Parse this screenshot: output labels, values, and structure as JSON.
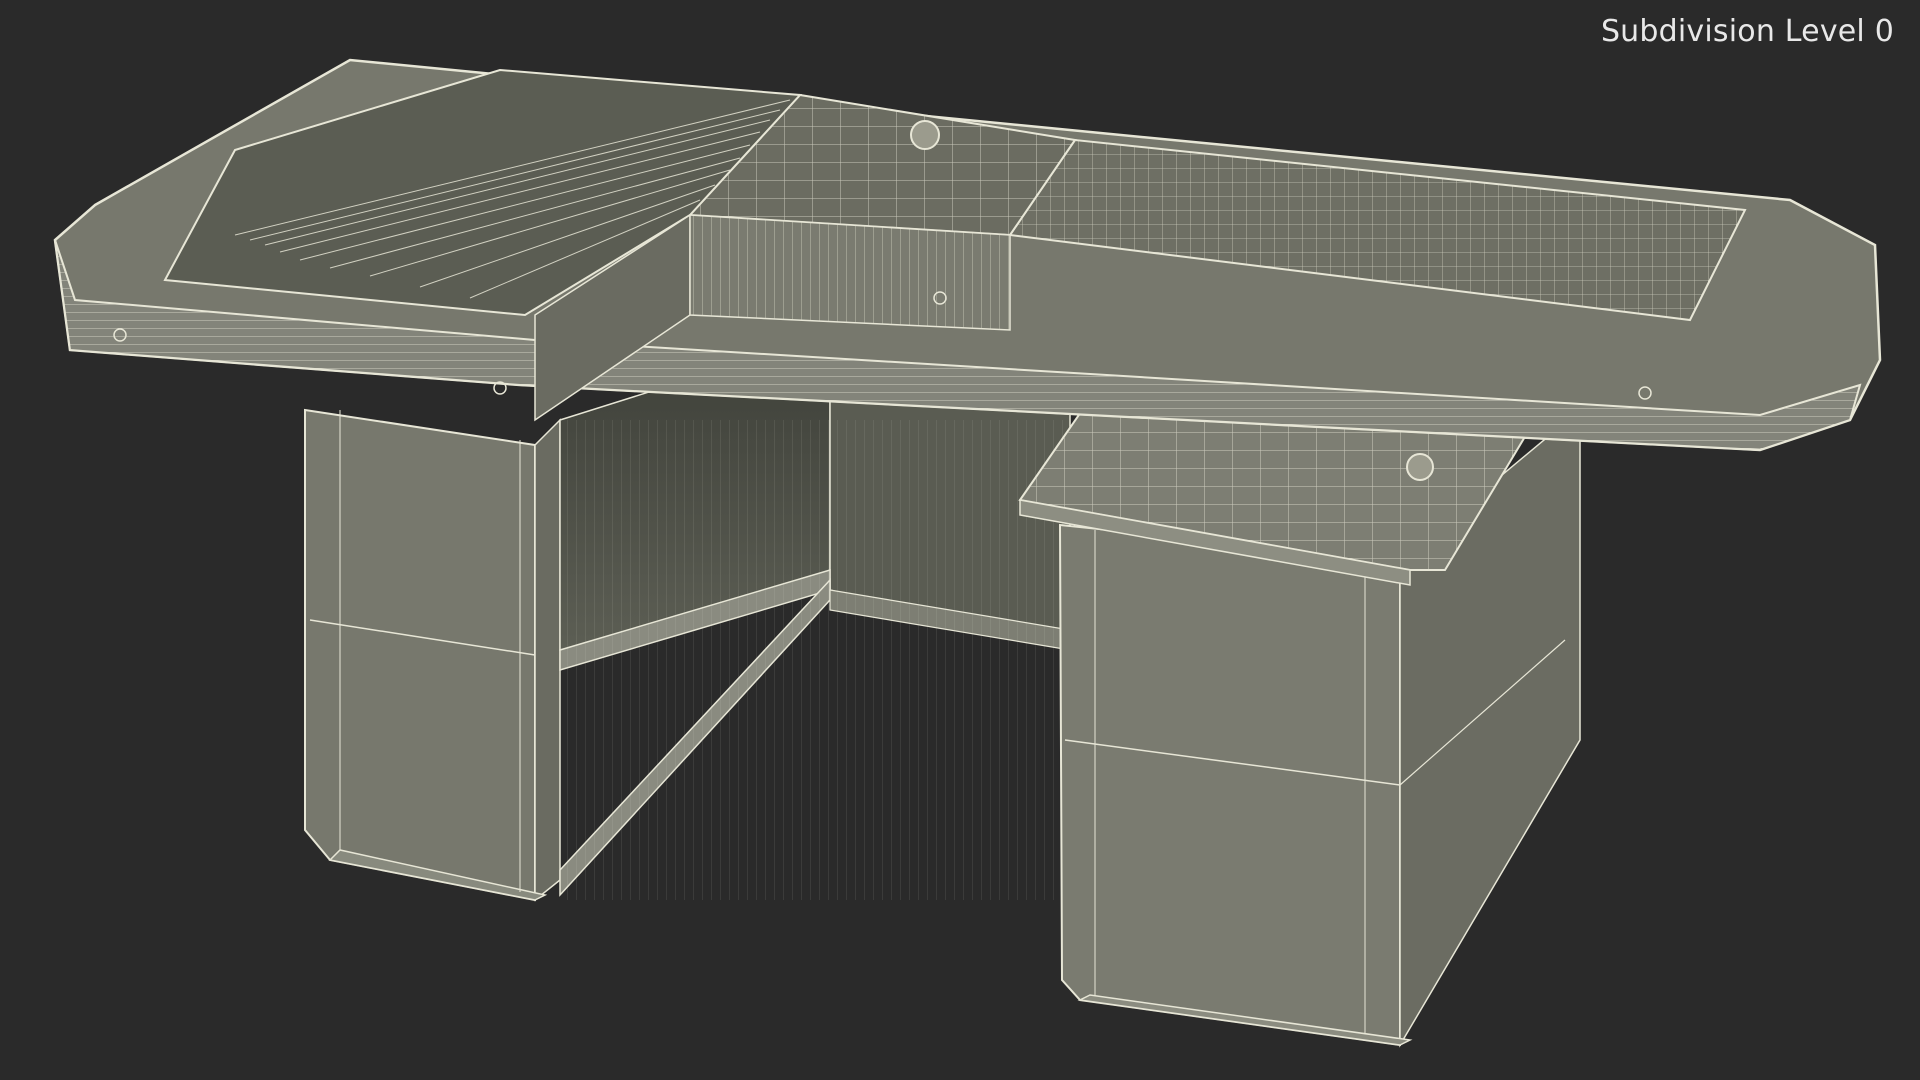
{
  "overlay": {
    "subdivision_label": "Subdivision Level 0"
  },
  "scene": {
    "subject": "checkout-counter-wireframe",
    "render_mode": "wireframe-on-shaded",
    "colors": {
      "background": "#2a2a2a",
      "surface_light": "#7d7d72",
      "surface_mid": "#6e6f64",
      "surface_dark": "#4b4d45",
      "wire": "#e7e6d6"
    }
  }
}
